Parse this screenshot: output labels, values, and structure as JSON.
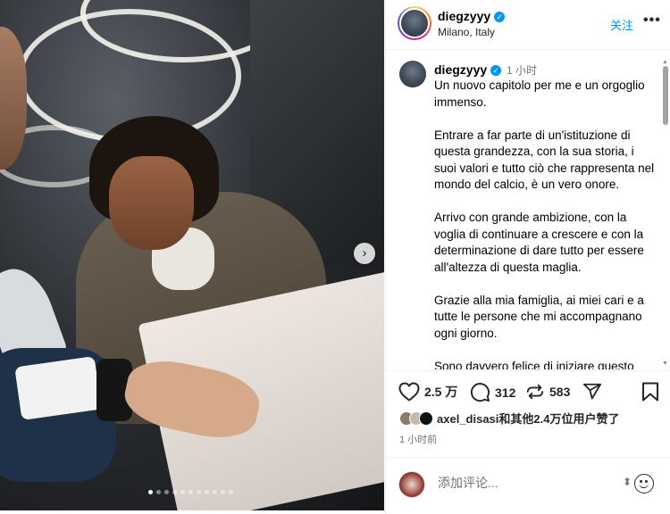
{
  "post": {
    "username": "diegzyyy",
    "location": "Milano, Italy",
    "follow_label": "关注",
    "more_label": "•••",
    "next_label": "›",
    "verified_mark": "✓",
    "carousel_total": 11,
    "carousel_index": 1
  },
  "caption": {
    "username": "diegzyyy",
    "time_ago": "1 小时",
    "paragraphs": [
      "Un nuovo capitolo per me e un orgoglio immenso.",
      "Entrare a far parte di un'istituzione di questa grandezza, con la sua storia, i suoi valori e tutto ciò che rappresenta nel mondo del calcio, è un vero onore.",
      "Arrivo con grande ambizione, con la voglia di continuare a crescere e con la determinazione di dare tutto per essere all'altezza di questa maglia.",
      "Grazie alla mia famiglia, ai miei cari e a tutte le persone che mi accompagnano ogni giorno.",
      "Sono davvero felice di iniziare questo"
    ]
  },
  "actions": {
    "likes_count": "2.5 万",
    "comments_count": "312",
    "reposts_count": "583",
    "icons": [
      "heart-icon",
      "comment-icon",
      "repost-icon",
      "share-icon",
      "bookmark-icon"
    ]
  },
  "likes": {
    "text": "axel_disasi和其他2.4万位用户赞了"
  },
  "post_time": "1 小时前",
  "comment_box": {
    "placeholder": "添加评论...",
    "expand_label": "⬍"
  },
  "colors": {
    "accent": "#0095f6",
    "text": "#262626",
    "muted": "#737373"
  }
}
